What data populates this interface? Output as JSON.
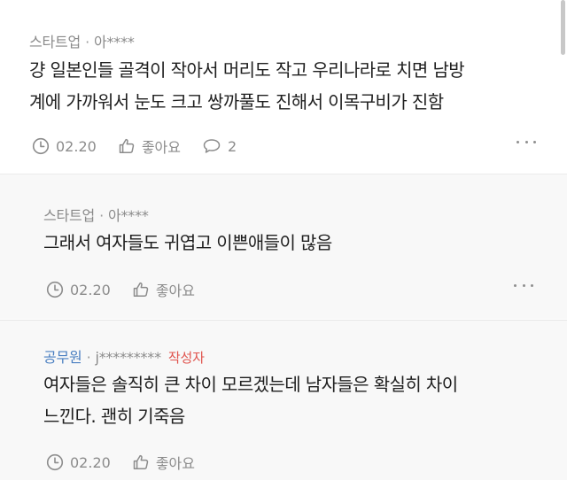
{
  "comments": [
    {
      "dept": "스타트업",
      "author": "아****",
      "lines": [
        "걍 일본인들 골격이 작아서 머리도 작고 우리나라로 치면 남방",
        "계에 가까워서 눈도 크고 쌍까풀도 진해서 이목구비가 진함"
      ],
      "date": "02.20",
      "like_label": "좋아요",
      "reply_count": "2"
    },
    {
      "dept": "스타트업",
      "author": "아****",
      "lines": [
        "그래서 여자들도 귀엽고 이쁜애들이 많음"
      ],
      "date": "02.20",
      "like_label": "좋아요"
    },
    {
      "dept": "공무원",
      "author": "j*********",
      "badge": "작성자",
      "lines": [
        "여자들은 솔직히 큰 차이 모르겠는데 남자들은 확실히 차이",
        "느낀다. 괜히 기죽음"
      ],
      "date": "02.20",
      "like_label": "좋아요"
    }
  ],
  "colors": {
    "dept_blue": "#4a7fc1",
    "author_badge_red": "#e0534d",
    "reply_background": "#f8f8f8"
  },
  "icons": {
    "date": "clock-icon",
    "like": "thumbs-up-icon",
    "reply": "speech-bubble-icon",
    "more": "more-dots-icon"
  }
}
